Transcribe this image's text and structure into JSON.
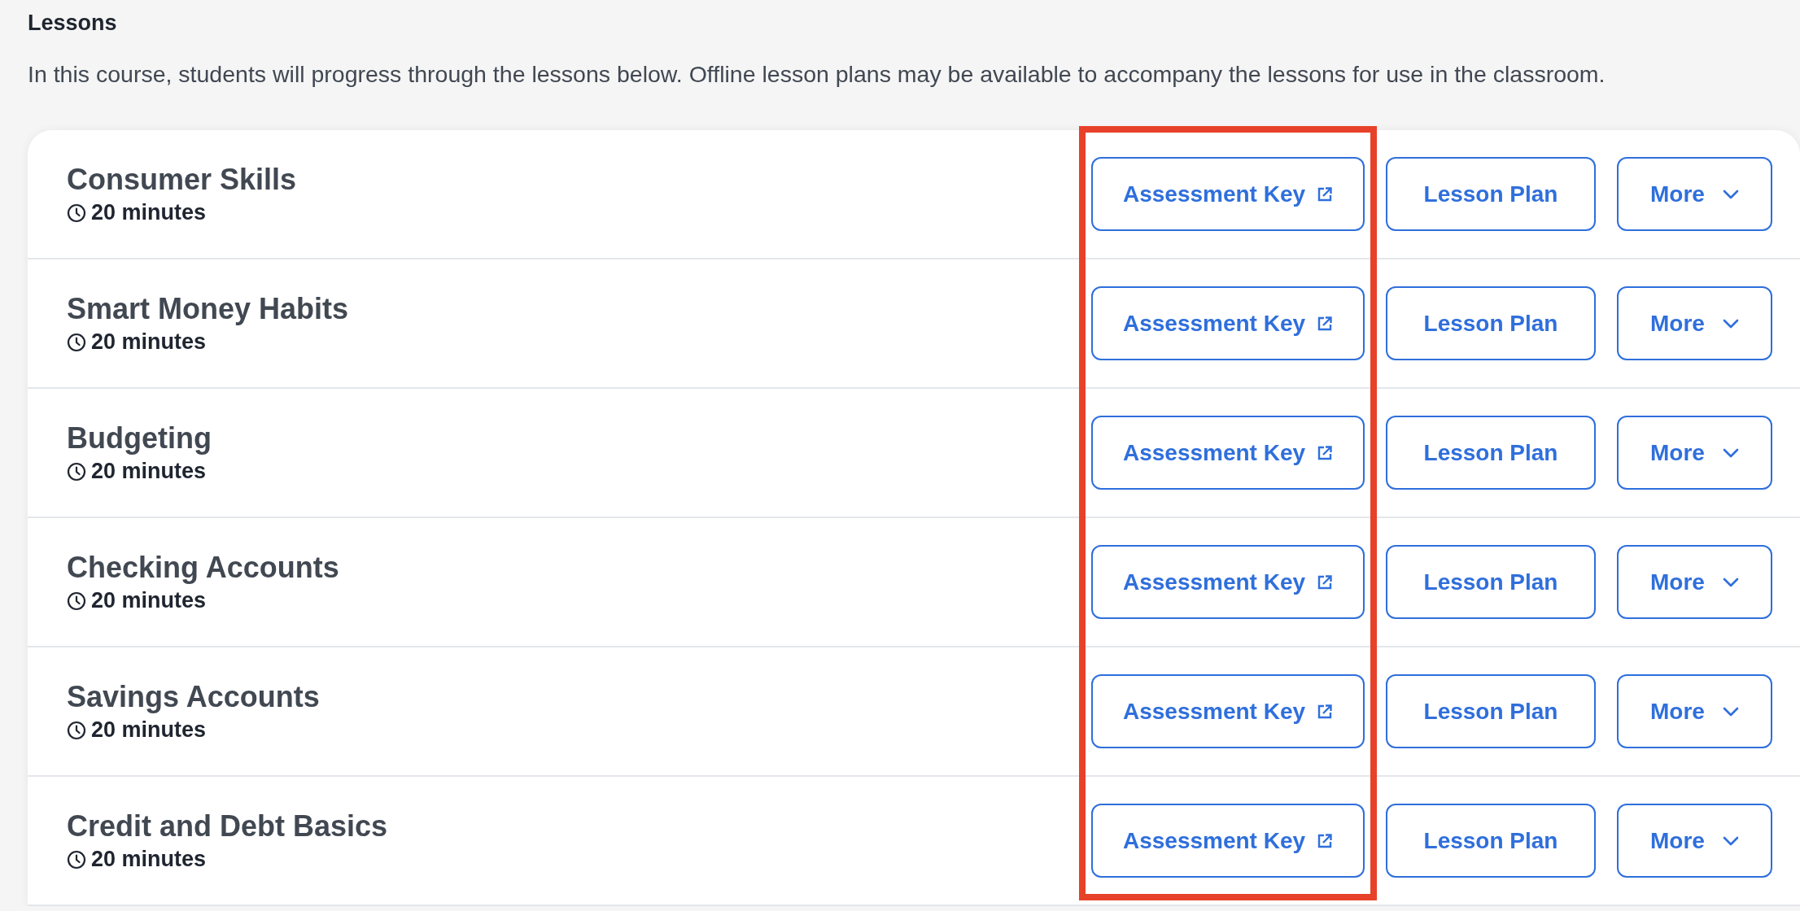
{
  "section": {
    "title": "Lessons",
    "description": "In this course, students will progress through the lessons below. Offline lesson plans may be available to accompany the lessons for use in the classroom."
  },
  "highlight": {
    "kind": "frame"
  },
  "lessons": [
    {
      "title": "Consumer Skills",
      "duration": "20 minutes",
      "buttons": [
        {
          "label": "Assessment Key",
          "kind": "external",
          "highlighted": true
        },
        {
          "label": "Lesson Plan",
          "kind": "plain"
        },
        {
          "label": "More",
          "kind": "dropdown"
        }
      ]
    },
    {
      "title": "Smart Money Habits",
      "duration": "20 minutes",
      "buttons": [
        {
          "label": "Assessment Key",
          "kind": "external",
          "highlighted": true
        },
        {
          "label": "Lesson Plan",
          "kind": "plain"
        },
        {
          "label": "More",
          "kind": "dropdown"
        }
      ]
    },
    {
      "title": "Budgeting",
      "duration": "20 minutes",
      "buttons": [
        {
          "label": "Assessment Key",
          "kind": "external",
          "highlighted": true
        },
        {
          "label": "Lesson Plan",
          "kind": "plain"
        },
        {
          "label": "More",
          "kind": "dropdown"
        }
      ]
    },
    {
      "title": "Checking Accounts",
      "duration": "20 minutes",
      "buttons": [
        {
          "label": "Assessment Key",
          "kind": "external",
          "highlighted": true
        },
        {
          "label": "Lesson Plan",
          "kind": "plain"
        },
        {
          "label": "More",
          "kind": "dropdown"
        }
      ]
    },
    {
      "title": "Savings Accounts",
      "duration": "20 minutes",
      "buttons": [
        {
          "label": "Assessment Key",
          "kind": "external",
          "highlighted": true
        },
        {
          "label": "Lesson Plan",
          "kind": "plain"
        },
        {
          "label": "More",
          "kind": "dropdown"
        }
      ]
    },
    {
      "title": "Credit and Debt Basics",
      "duration": "20 minutes",
      "buttons": [
        {
          "label": "Assessment Key",
          "kind": "external",
          "highlighted": true
        },
        {
          "label": "Lesson Plan",
          "kind": "plain"
        },
        {
          "label": "More",
          "kind": "dropdown"
        }
      ]
    }
  ]
}
